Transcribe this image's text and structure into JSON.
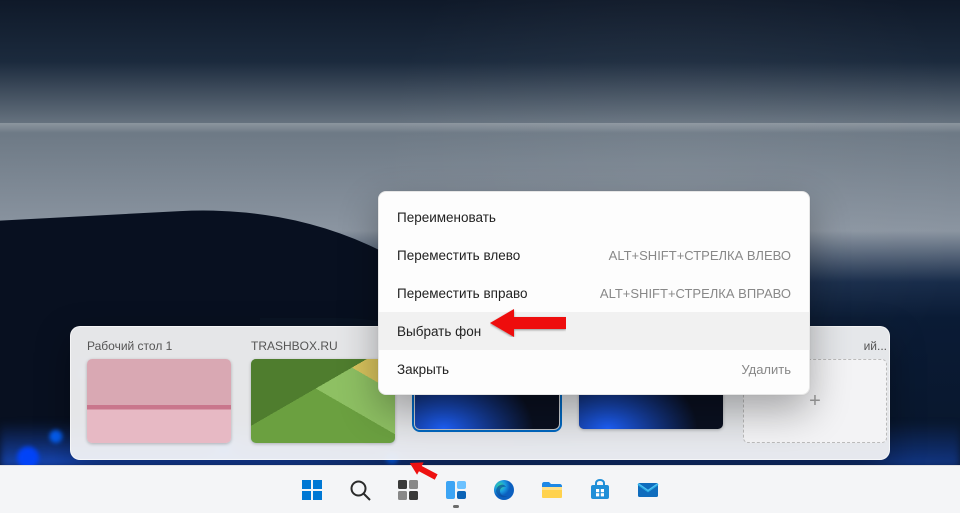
{
  "taskview": {
    "desktops": [
      {
        "label": "Рабочий стол 1",
        "thumb": "pink",
        "selected": false
      },
      {
        "label": "TRASHBOX.RU",
        "thumb": "green",
        "selected": false
      },
      {
        "label": "",
        "thumb": "bio",
        "selected": true
      },
      {
        "label": "",
        "thumb": "bio",
        "selected": false,
        "truncated_label": "ий..."
      }
    ],
    "new_desktop_plus": "+"
  },
  "context_menu": {
    "items": [
      {
        "label": "Переименовать",
        "shortcut": "",
        "hover": false
      },
      {
        "label": "Переместить влево",
        "shortcut": "ALT+SHIFT+СТРЕЛКА ВЛЕВО",
        "hover": false
      },
      {
        "label": "Переместить вправо",
        "shortcut": "ALT+SHIFT+СТРЕЛКА ВПРАВО",
        "hover": false
      },
      {
        "label": "Выбрать фон",
        "shortcut": "",
        "hover": true
      },
      {
        "label": "Закрыть",
        "secondary": "Удалить",
        "hover": false
      }
    ]
  },
  "taskbar": {
    "icons": [
      {
        "name": "start-icon"
      },
      {
        "name": "search-icon"
      },
      {
        "name": "widgets-icon"
      },
      {
        "name": "taskview-icon",
        "active": true
      },
      {
        "name": "edge-icon"
      },
      {
        "name": "explorer-icon"
      },
      {
        "name": "store-icon"
      },
      {
        "name": "mail-icon"
      }
    ]
  }
}
